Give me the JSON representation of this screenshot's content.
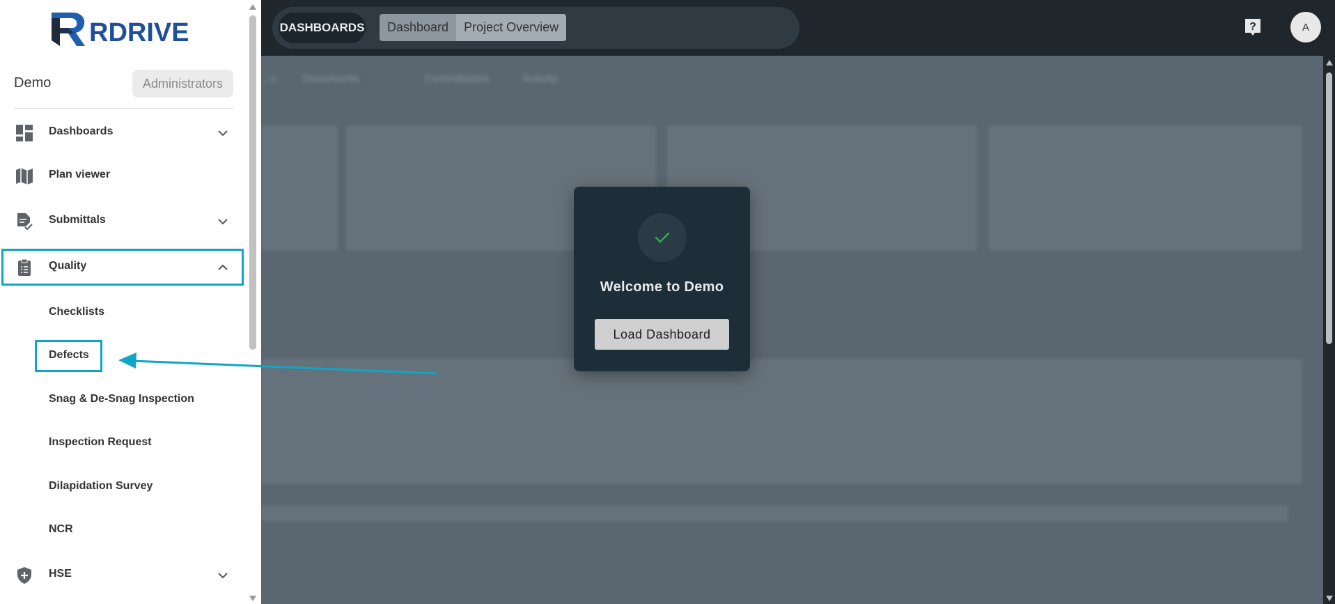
{
  "app": {
    "logo_text": "RDRIVE"
  },
  "header": {
    "section_label": "DASHBOARDS",
    "tabs": [
      {
        "label": "Dashboard"
      },
      {
        "label": "Project Overview"
      }
    ],
    "help_icon": "help-icon",
    "avatar_initial": "A"
  },
  "sidebar": {
    "project_name": "Demo",
    "role_badge": "Administrators",
    "items": [
      {
        "label": "Dashboards",
        "icon": "dashboard-icon",
        "expandable": true
      },
      {
        "label": "Plan viewer",
        "icon": "map-icon",
        "expandable": false
      },
      {
        "label": "Submittals",
        "icon": "document-check-icon",
        "expandable": true
      },
      {
        "label": "Quality",
        "icon": "clipboard-icon",
        "expandable": true,
        "expanded": true
      },
      {
        "label": "HSE",
        "icon": "shield-plus-icon",
        "expandable": true
      }
    ],
    "quality_children": [
      {
        "label": "Checklists"
      },
      {
        "label": "Defects"
      },
      {
        "label": "Snag & De-Snag Inspection"
      },
      {
        "label": "Inspection Request"
      },
      {
        "label": "Dilapidation Survey"
      },
      {
        "label": "NCR"
      }
    ]
  },
  "background_tabs": [
    "...s",
    "Documents",
    "Controllables",
    "Activity"
  ],
  "modal": {
    "icon": "check-icon",
    "title": "Welcome to Demo",
    "button_label": "Load Dashboard"
  },
  "annotation": {
    "highlight_color": "#0ea5c6",
    "arrow_target": "Defects"
  },
  "colors": {
    "topbar": "#1f262c",
    "modal_bg": "#1e2e38",
    "check_green": "#3aa757",
    "accent": "#0ea5c6"
  }
}
